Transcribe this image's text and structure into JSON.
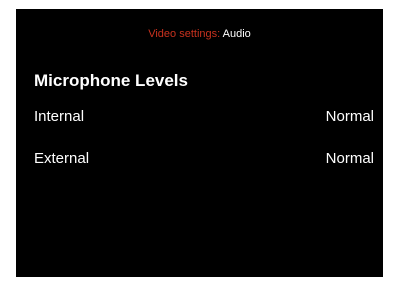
{
  "header": {
    "prefix": "Video settings:",
    "current": "Audio",
    "prefix_color": "#c8321e"
  },
  "section": {
    "title": "Microphone Levels"
  },
  "rows": [
    {
      "label": "Internal",
      "value": "Normal"
    },
    {
      "label": "External",
      "value": "Normal"
    }
  ]
}
